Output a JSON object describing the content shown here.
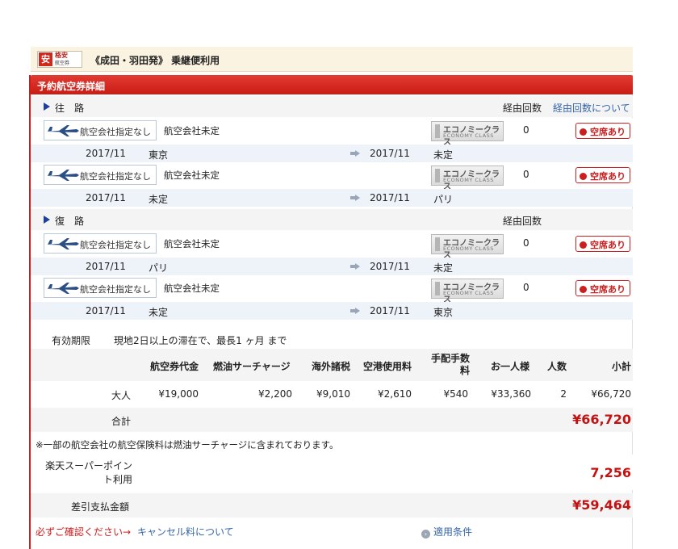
{
  "header": {
    "logo_mark": "安",
    "logo_line1": "格安",
    "logo_line2": "航空券",
    "title": "《成田・羽田発》 乗継便利用"
  },
  "panel": {
    "title": "予約航空券詳細"
  },
  "outbound": {
    "label": "往　路",
    "hops_label": "経由回数",
    "hops_link": "経由回数について",
    "flights": [
      {
        "airline": "航空会社指定なし",
        "carrier": "航空会社未定",
        "class_jp": "エコノミークラス",
        "class_en": "ECONOMY CLASS",
        "stops": "0",
        "availability": "空席あり",
        "dep_date": "2017/11",
        "dep_city": "東京",
        "arr_date": "2017/11",
        "arr_city": "未定"
      },
      {
        "airline": "航空会社指定なし",
        "carrier": "航空会社未定",
        "class_jp": "エコノミークラス",
        "class_en": "ECONOMY CLASS",
        "stops": "0",
        "availability": "空席あり",
        "dep_date": "2017/11",
        "dep_city": "未定",
        "arr_date": "2017/11",
        "arr_city": "パリ"
      }
    ]
  },
  "return": {
    "label": "復　路",
    "hops_label": "経由回数",
    "flights": [
      {
        "airline": "航空会社指定なし",
        "carrier": "航空会社未定",
        "class_jp": "エコノミークラス",
        "class_en": "ECONOMY CLASS",
        "stops": "0",
        "availability": "空席あり",
        "dep_date": "2017/11",
        "dep_city": "パリ",
        "arr_date": "2017/11",
        "arr_city": "未定"
      },
      {
        "airline": "航空会社指定なし",
        "carrier": "航空会社未定",
        "class_jp": "エコノミークラス",
        "class_en": "ECONOMY CLASS",
        "stops": "0",
        "availability": "空席あり",
        "dep_date": "2017/11",
        "dep_city": "未定",
        "arr_date": "2017/11",
        "arr_city": "東京"
      }
    ]
  },
  "validity": {
    "label": "有効期限",
    "text": "現地2日以上の滞在で、最長1 ヶ月 まで"
  },
  "fare": {
    "headers": {
      "ticket": "航空券代金",
      "fuel": "燃油サーチャージ",
      "overseas": "海外諸税",
      "airport": "空港使用料",
      "handling": "手配手数料",
      "per_person": "お一人様",
      "count": "人数",
      "subtotal": "小計"
    },
    "rows": [
      {
        "type": "大人",
        "ticket": "¥19,000",
        "fuel": "¥2,200",
        "overseas": "¥9,010",
        "airport": "¥2,610",
        "handling": "¥540",
        "per_person": "¥33,360",
        "count": "2",
        "subtotal": "¥66,720"
      }
    ],
    "total_label": "合計",
    "total": "¥66,720"
  },
  "note": "※一部の航空会社の航空保険料は燃油サーチャージに含まれております。",
  "points": {
    "label": "楽天スーパーポイント利用",
    "value": "7,256"
  },
  "payment": {
    "label": "差引支払金額",
    "value": "¥59,464"
  },
  "footer": {
    "confirm": "必ずご確認ください→",
    "cancel_link": "キャンセル料について",
    "conditions": "適用条件"
  }
}
